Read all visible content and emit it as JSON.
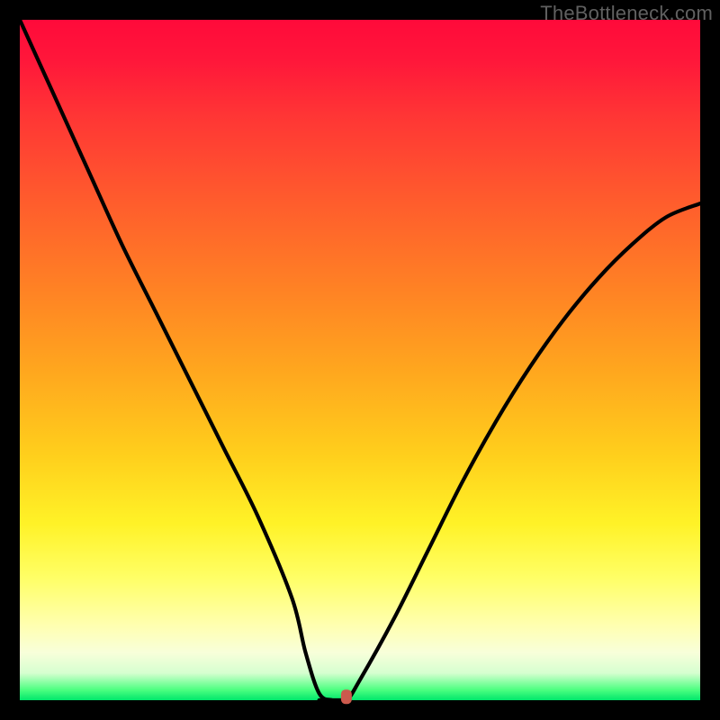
{
  "watermark": "TheBottleneck.com",
  "chart_data": {
    "type": "line",
    "title": "",
    "xlabel": "",
    "ylabel": "",
    "xlim": [
      0,
      100
    ],
    "ylim": [
      0,
      100
    ],
    "x": [
      0,
      5,
      10,
      15,
      20,
      25,
      30,
      35,
      40,
      42,
      44,
      46,
      48,
      50,
      55,
      60,
      65,
      70,
      75,
      80,
      85,
      90,
      95,
      100
    ],
    "values": [
      100,
      89,
      78,
      67,
      57,
      47,
      37,
      27,
      15,
      7,
      1,
      0,
      0,
      3,
      12,
      22,
      32,
      41,
      49,
      56,
      62,
      67,
      71,
      73
    ],
    "min_point": {
      "x": 47,
      "y": 0
    },
    "flat_segment": {
      "x_start": 44,
      "x_end": 48,
      "y": 0
    },
    "marker": {
      "x": 48,
      "y": 0.5,
      "color": "#cc5a4d"
    },
    "background_gradient": {
      "top": "#ff0a3a",
      "mid_upper": "#ff8324",
      "mid": "#fff227",
      "lower": "#ffffb0",
      "bottom": "#00e66b"
    }
  }
}
